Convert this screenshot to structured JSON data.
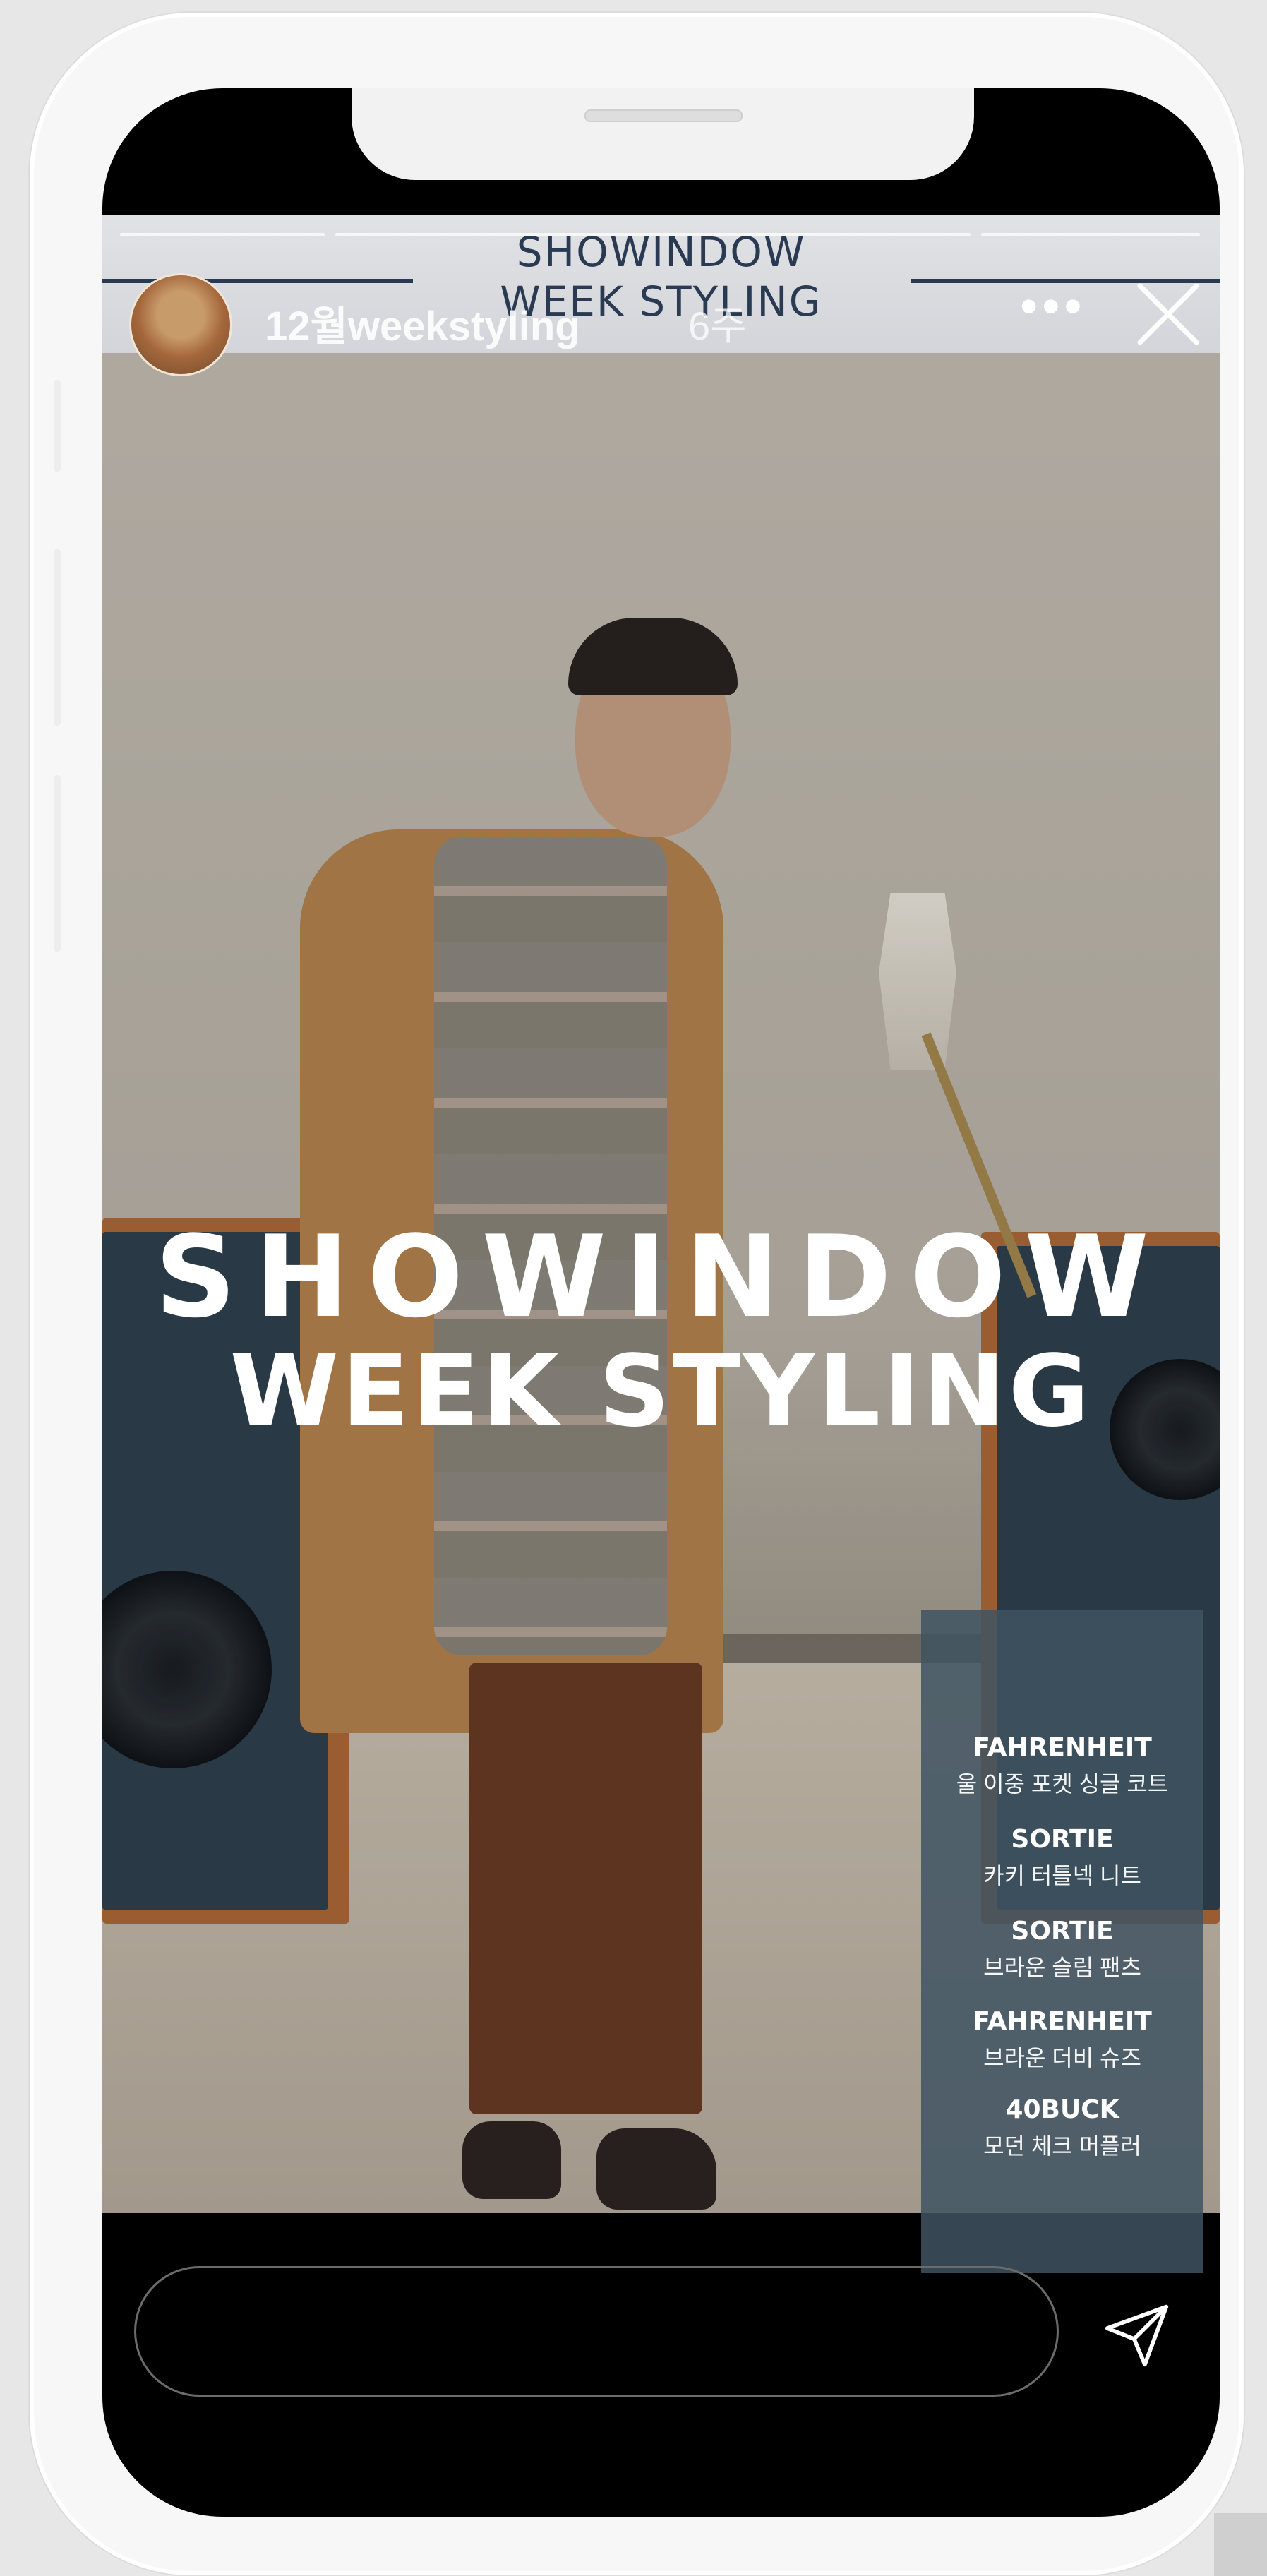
{
  "story": {
    "banner_line1": "SHOWINDOW",
    "banner_line2": "WEEK STYLING",
    "username": "12월weekstyling",
    "time": "6주",
    "more_icon": "ellipsis-icon",
    "close_icon": "close-icon"
  },
  "headline": {
    "line1": "SHOWINDOW",
    "line2": "WEEK STYLING"
  },
  "credits": [
    {
      "brand": "FAHRENHEIT",
      "item": "울 이중 포켓 싱글 코트"
    },
    {
      "brand": "SORTIE",
      "item": "카키 터틀넥 니트"
    },
    {
      "brand": "SORTIE",
      "item": "브라운 슬림 팬츠"
    },
    {
      "brand": "FAHRENHEIT",
      "item": "브라운 더비 슈즈"
    },
    {
      "brand": "40BUCK",
      "item": "모던 체크 머플러"
    }
  ],
  "reply": {
    "placeholder": "",
    "send_icon": "send-icon"
  },
  "colors": {
    "banner_text": "#2a3a52",
    "credit_panel": "#3f5462",
    "screen_bg": "#000000"
  }
}
